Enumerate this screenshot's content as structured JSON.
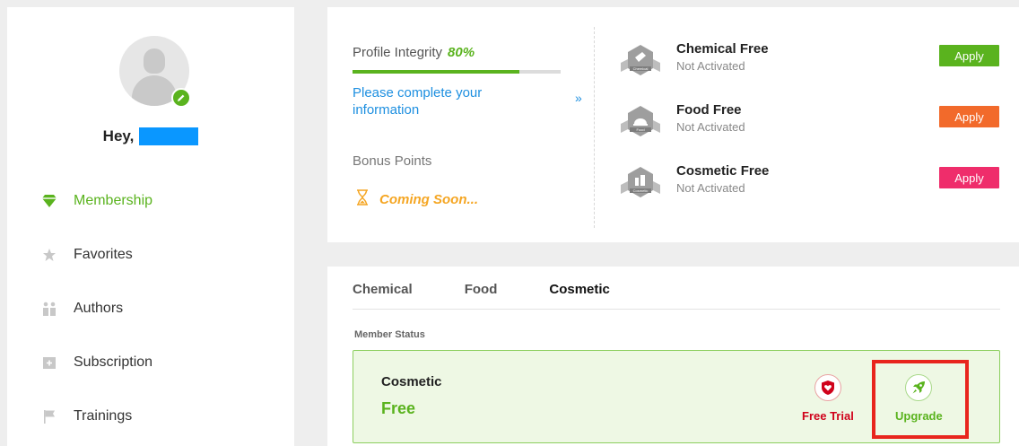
{
  "sidebar": {
    "greeting": "Hey,",
    "items": [
      {
        "label": "Membership",
        "icon": "diamond-icon",
        "active": true
      },
      {
        "label": "Favorites",
        "icon": "star-icon",
        "active": false
      },
      {
        "label": "Authors",
        "icon": "people-icon",
        "active": false
      },
      {
        "label": "Subscription",
        "icon": "folder-plus-icon",
        "active": false
      },
      {
        "label": "Trainings",
        "icon": "flag-icon",
        "active": false
      }
    ]
  },
  "profile": {
    "title": "Profile Integrity",
    "percent_label": "80%",
    "progress_fraction": 0.8,
    "complete_link": "Please complete your information",
    "chevron": "»",
    "bonus_title": "Bonus Points",
    "bonus_status": "Coming Soon..."
  },
  "free_programs": [
    {
      "title": "Chemical Free",
      "status": "Not Activated",
      "button": "Apply",
      "color": "#5ab31e",
      "badge_text": "Chemical"
    },
    {
      "title": "Food Free",
      "status": "Not Activated",
      "button": "Apply",
      "color": "#f26a2b",
      "badge_text": "Food"
    },
    {
      "title": "Cosmetic Free",
      "status": "Not Activated",
      "button": "Apply",
      "color": "#ef2d6b",
      "badge_text": "Cosmetic"
    }
  ],
  "membership": {
    "tabs": [
      "Chemical",
      "Food",
      "Cosmetic"
    ],
    "active_tab": "Cosmetic",
    "section_label": "Member Status",
    "current_name": "Cosmetic",
    "current_level": "Free",
    "free_trial_label": "Free Trial",
    "upgrade_label": "Upgrade"
  },
  "colors": {
    "accent_green": "#5ab31e",
    "link_blue": "#1d8fe0",
    "warning_orange": "#f5a623",
    "trial_red": "#d0021b",
    "highlight_red": "#e8251d"
  }
}
